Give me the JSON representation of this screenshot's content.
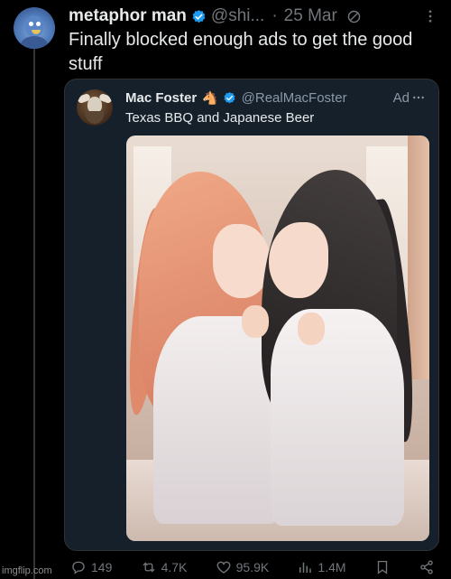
{
  "post": {
    "author_name": "metaphor man",
    "handle": "@shi...",
    "separator": "·",
    "date": "25 Mar",
    "text": "Finally blocked enough ads to get the good stuff"
  },
  "ad": {
    "author_name": "Mac Foster",
    "badge_emoji": "🐴",
    "handle": "@RealMacFoster",
    "label": "Ad",
    "text": "Texas BBQ and Japanese Beer"
  },
  "actions": {
    "replies": "149",
    "reposts": "4.7K",
    "likes": "95.9K",
    "views": "1.4M"
  },
  "watermark": "imgflip.com",
  "colors": {
    "background": "#000000",
    "card_background": "#15202b",
    "verified": "#1d9bf0",
    "muted_text": "#71767b"
  }
}
